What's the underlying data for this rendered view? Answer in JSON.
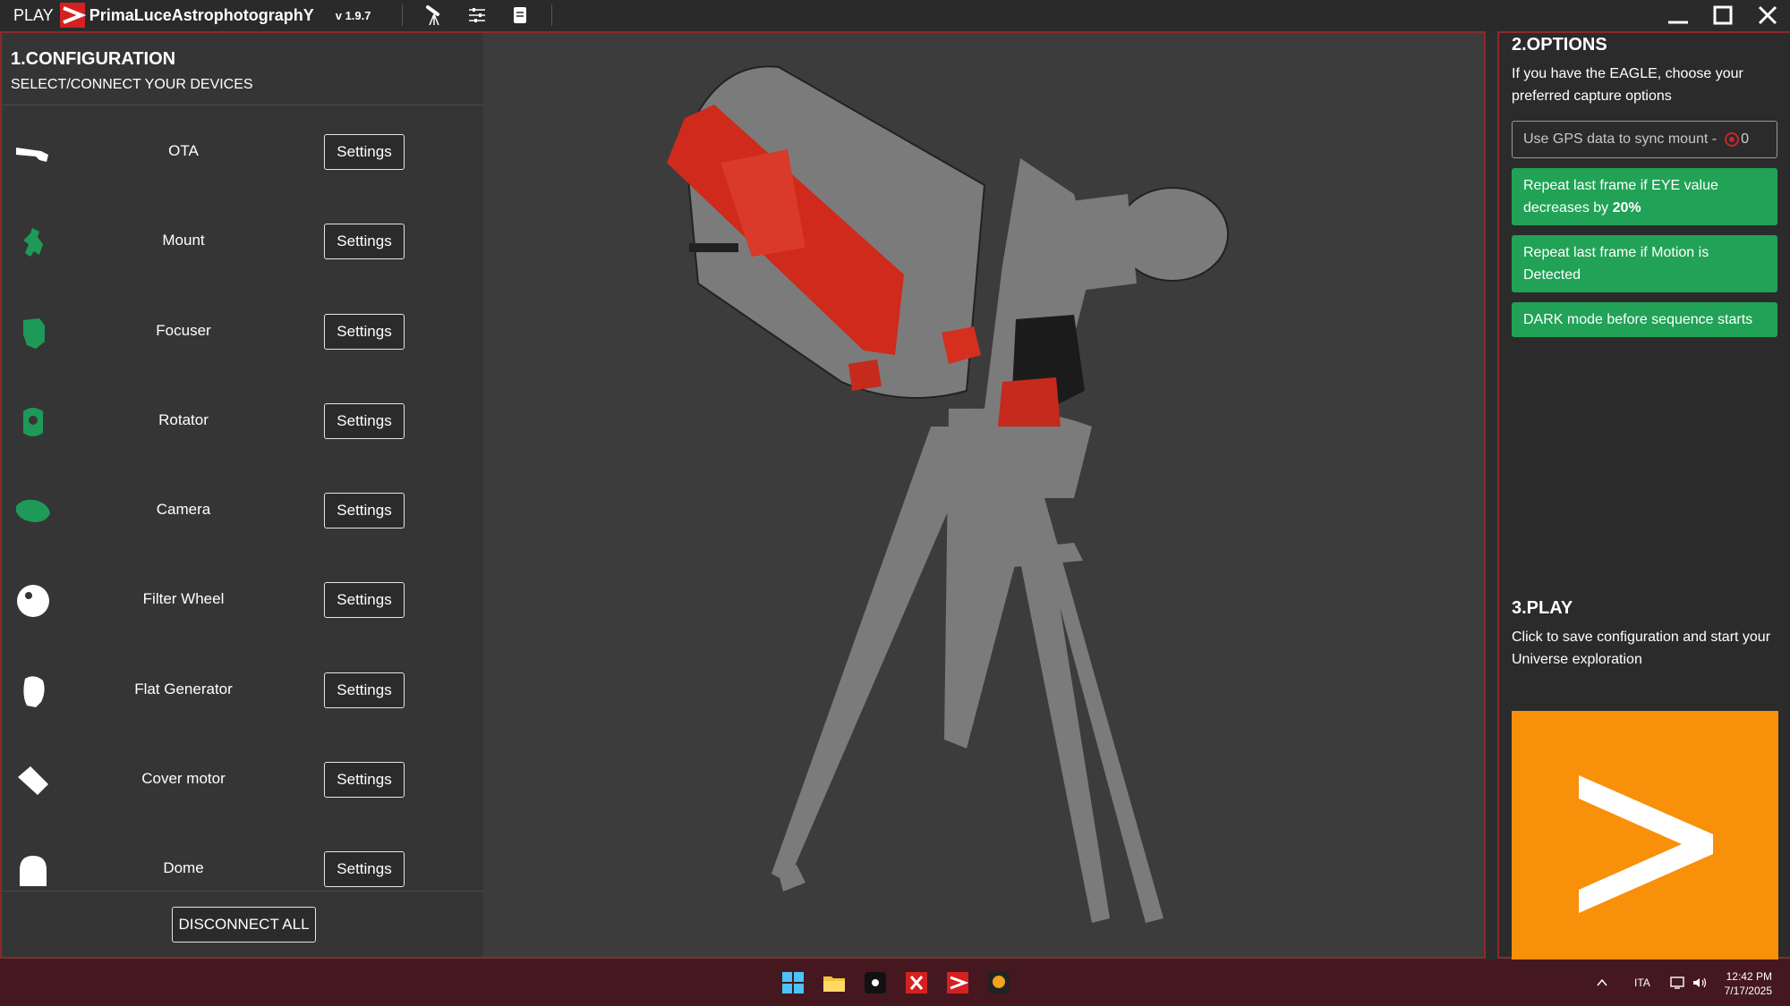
{
  "titlebar": {
    "play": "PLAY",
    "brand": "PrimaLuceAstrophotographY",
    "version": "v 1.9.7",
    "icons": [
      "telescope-icon",
      "sliders-icon",
      "document-icon"
    ]
  },
  "config": {
    "title": "1.CONFIGURATION",
    "subtitle": "SELECT/CONNECT YOUR DEVICES",
    "settings_label": "Settings",
    "devices": [
      {
        "name": "OTA",
        "icon": "ota-icon",
        "color": "#ffffff"
      },
      {
        "name": "Mount",
        "icon": "mount-icon",
        "color": "#1d9a57"
      },
      {
        "name": "Focuser",
        "icon": "focuser-icon",
        "color": "#1d9a57"
      },
      {
        "name": "Rotator",
        "icon": "rotator-icon",
        "color": "#1d9a57"
      },
      {
        "name": "Camera",
        "icon": "camera-icon",
        "color": "#1d9a57"
      },
      {
        "name": "Filter Wheel",
        "icon": "filter-wheel-icon",
        "color": "#ffffff"
      },
      {
        "name": "Flat Generator",
        "icon": "flat-generator-icon",
        "color": "#ffffff"
      },
      {
        "name": "Cover motor",
        "icon": "cover-motor-icon",
        "color": "#ffffff"
      },
      {
        "name": "Dome",
        "icon": "dome-icon",
        "color": "#ffffff"
      }
    ],
    "disconnect_label": "DISCONNECT ALL"
  },
  "options": {
    "title": "2.OPTIONS",
    "description": "If you have the EAGLE, choose your preferred capture options",
    "gps_label": "Use GPS data to sync mount  -",
    "gps_count": "0",
    "buttons": [
      {
        "text": "Repeat last frame if EYE value decreases by ",
        "bold": "20%"
      },
      {
        "text": "Repeat last frame if Motion is Detected",
        "bold": ""
      },
      {
        "text": "DARK mode before sequence starts",
        "bold": ""
      }
    ]
  },
  "play": {
    "title": "3.PLAY",
    "description": "Click to save configuration and start your Universe exploration"
  },
  "taskbar": {
    "tray_lang": "ITA",
    "time": "12:42 PM",
    "date": "7/17/2025"
  },
  "colors": {
    "accent_red": "#e02424",
    "green": "#21a256",
    "orange": "#f8900a"
  }
}
